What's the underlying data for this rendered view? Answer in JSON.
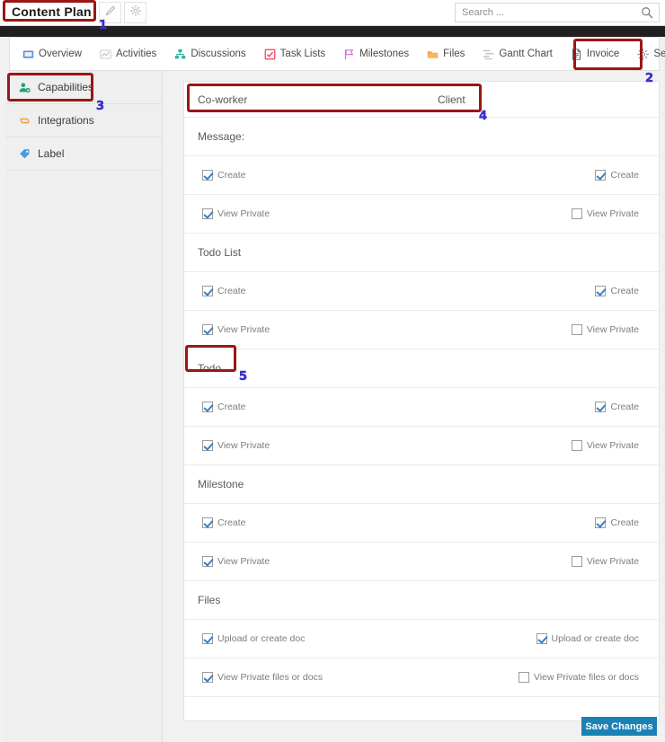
{
  "window": {
    "title": "Content Plan"
  },
  "toolbar": {
    "edit_icon": "pencil-icon",
    "settings_icon": "gear-icon"
  },
  "search": {
    "placeholder": "Search ...",
    "value": "",
    "icon": "search-icon"
  },
  "tabs": [
    {
      "label": "Overview",
      "icon": "overview-icon",
      "active": false
    },
    {
      "label": "Activities",
      "icon": "activities-icon",
      "active": false
    },
    {
      "label": "Discussions",
      "icon": "discussions-icon",
      "active": false
    },
    {
      "label": "Task Lists",
      "icon": "task-lists-icon",
      "active": false
    },
    {
      "label": "Milestones",
      "icon": "milestones-icon",
      "active": false
    },
    {
      "label": "Files",
      "icon": "files-icon",
      "active": false
    },
    {
      "label": "Gantt Chart",
      "icon": "gantt-chart-icon",
      "active": false
    },
    {
      "label": "Invoice",
      "icon": "invoice-icon",
      "active": false
    },
    {
      "label": "Settings",
      "icon": "settings-icon",
      "active": true
    }
  ],
  "sidebar": {
    "items": [
      {
        "label": "Capabilities",
        "icon": "capabilities-icon",
        "active": true
      },
      {
        "label": "Integrations",
        "icon": "integrations-icon",
        "active": false
      },
      {
        "label": "Label",
        "icon": "label-tag-icon",
        "active": false
      }
    ]
  },
  "permissions": {
    "column_headers": {
      "left": "Co-worker",
      "right": "Client"
    },
    "sections": [
      {
        "title": "Message:",
        "rows": [
          {
            "label": "Create",
            "coworker": true,
            "client": true
          },
          {
            "label": "View Private",
            "coworker": true,
            "client": false
          }
        ]
      },
      {
        "title": "Todo List",
        "rows": [
          {
            "label": "Create",
            "coworker": true,
            "client": true
          },
          {
            "label": "View Private",
            "coworker": true,
            "client": false
          }
        ]
      },
      {
        "title": "Todo",
        "rows": [
          {
            "label": "Create",
            "coworker": true,
            "client": true
          },
          {
            "label": "View Private",
            "coworker": true,
            "client": false
          }
        ]
      },
      {
        "title": "Milestone",
        "rows": [
          {
            "label": "Create",
            "coworker": true,
            "client": true
          },
          {
            "label": "View Private",
            "coworker": true,
            "client": false
          }
        ]
      },
      {
        "title": "Files",
        "rows": [
          {
            "label": "Upload or create doc",
            "coworker": true,
            "client": true
          },
          {
            "label": "View Private files or docs",
            "coworker": true,
            "client": false
          }
        ]
      }
    ]
  },
  "footer": {
    "save_label": "Save Changes"
  },
  "annotations": {
    "accent_box": "#9c1616",
    "accent_num": "#3b2fd0",
    "markers": [
      {
        "num": "1",
        "target": "project-title"
      },
      {
        "num": "2",
        "target": "tab-settings"
      },
      {
        "num": "3",
        "target": "sidebar-item-capabilities"
      },
      {
        "num": "4",
        "target": "permissions-column-header-row"
      },
      {
        "num": "5",
        "target": "section-title-todo"
      }
    ]
  }
}
